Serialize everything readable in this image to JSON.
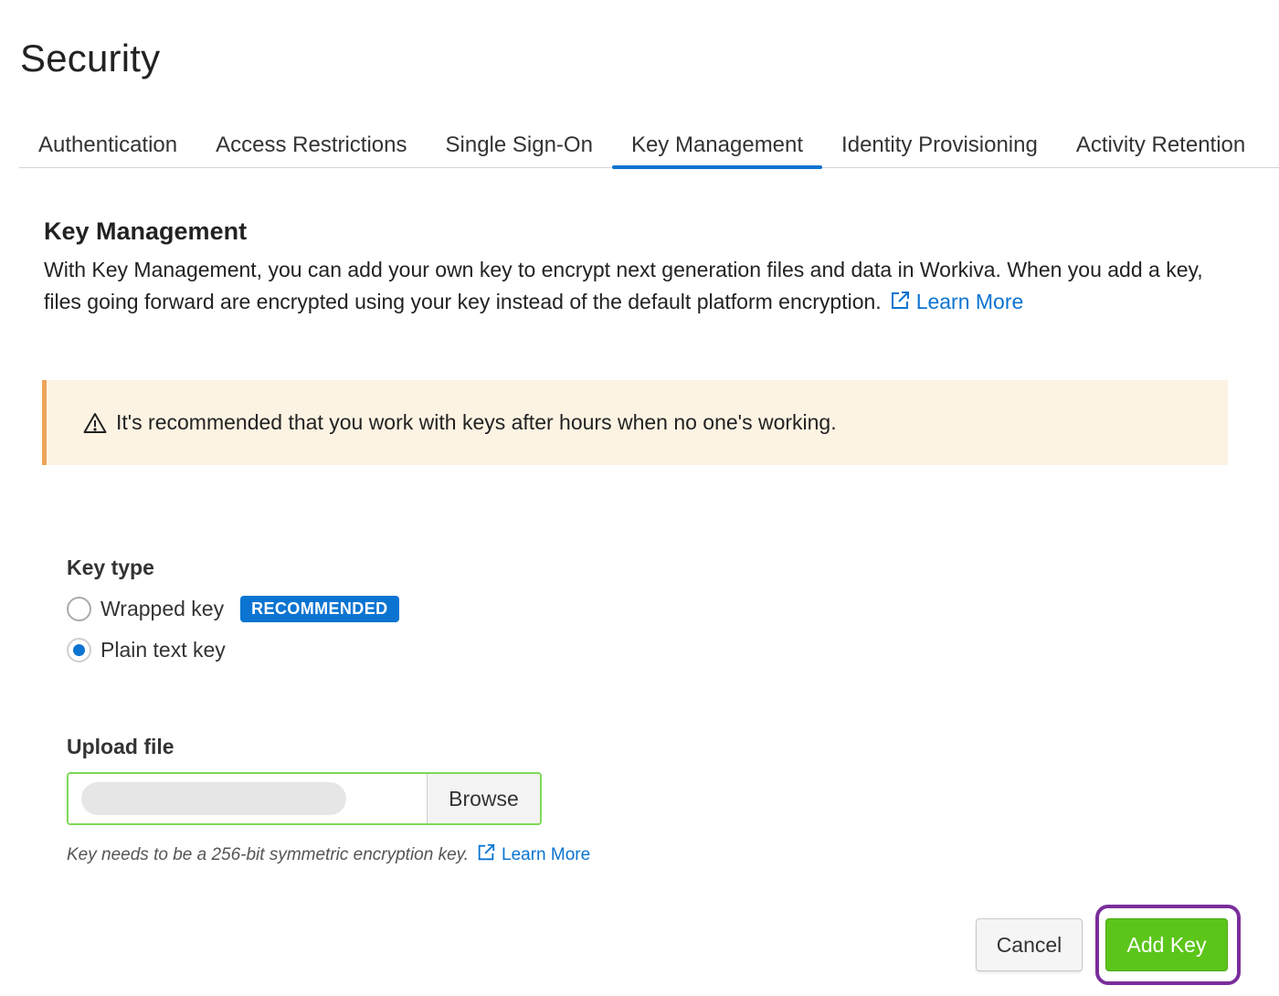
{
  "page": {
    "title": "Security"
  },
  "tabs": [
    {
      "label": "Authentication",
      "active": false
    },
    {
      "label": "Access Restrictions",
      "active": false
    },
    {
      "label": "Single Sign-On",
      "active": false
    },
    {
      "label": "Key Management",
      "active": true
    },
    {
      "label": "Identity Provisioning",
      "active": false
    },
    {
      "label": "Activity Retention",
      "active": false
    }
  ],
  "section": {
    "heading": "Key Management",
    "description": "With Key Management, you can add your own key to encrypt next generation files and data in Workiva. When you add a key, files going forward are encrypted using your key instead of the default platform encryption.",
    "learn_more": "Learn More"
  },
  "alert": {
    "icon": "warning-icon",
    "text": "It's recommended that you work with keys after hours when no one's working."
  },
  "key_type": {
    "label": "Key type",
    "options": [
      {
        "label": "Wrapped key",
        "badge": "RECOMMENDED",
        "selected": false
      },
      {
        "label": "Plain text key",
        "selected": true
      }
    ]
  },
  "upload": {
    "label": "Upload file",
    "browse_label": "Browse",
    "help_text": "Key needs to be a 256-bit symmetric encryption key.",
    "learn_more": "Learn More"
  },
  "actions": {
    "cancel_label": "Cancel",
    "add_label": "Add Key"
  },
  "colors": {
    "accent": "#0b74d1",
    "primary_button": "#5cc51a",
    "alert_border": "#f0a45b",
    "alert_background": "#fdf3e3",
    "focus_ring": "#7b2d9c"
  }
}
